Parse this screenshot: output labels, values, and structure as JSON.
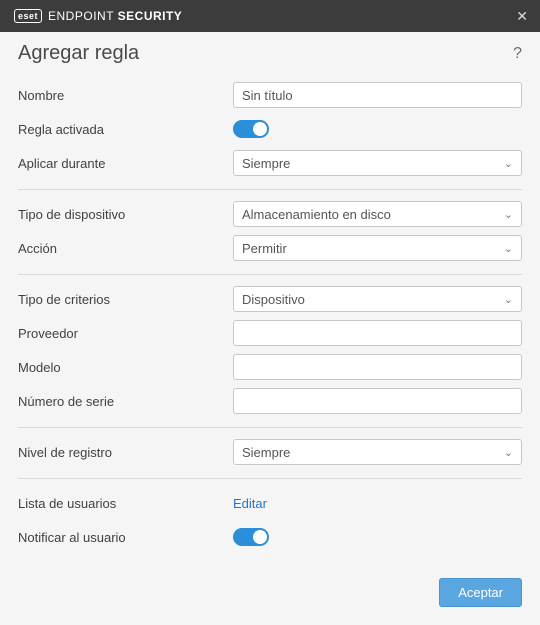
{
  "titlebar": {
    "brand_logo": "eset",
    "brand_light": "ENDPOINT ",
    "brand_bold": "SECURITY",
    "close_glyph": "✕"
  },
  "header": {
    "title": "Agregar regla",
    "help_glyph": "?"
  },
  "fields": {
    "name_label": "Nombre",
    "name_value": "Sin título",
    "enabled_label": "Regla activada",
    "apply_during_label": "Aplicar durante",
    "apply_during_value": "Siempre",
    "device_type_label": "Tipo de dispositivo",
    "device_type_value": "Almacenamiento en disco",
    "action_label": "Acción",
    "action_value": "Permitir",
    "criteria_type_label": "Tipo de criterios",
    "criteria_type_value": "Dispositivo",
    "vendor_label": "Proveedor",
    "vendor_value": "",
    "model_label": "Modelo",
    "model_value": "",
    "serial_label": "Número de serie",
    "serial_value": "",
    "log_level_label": "Nivel de registro",
    "log_level_value": "Siempre",
    "user_list_label": "Lista de usuarios",
    "user_list_action": "Editar",
    "notify_label": "Notificar al usuario"
  },
  "toggles": {
    "enabled": true,
    "notify": true
  },
  "footer": {
    "accept_label": "Aceptar"
  },
  "glyphs": {
    "chevron_down": "⌄"
  }
}
